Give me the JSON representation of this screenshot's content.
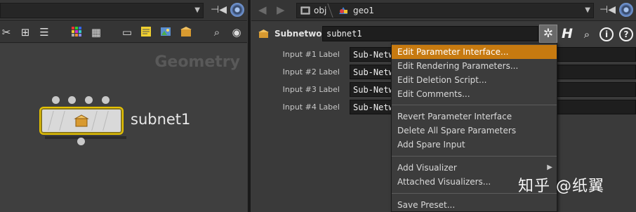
{
  "left_pane": {
    "network_label": "Geometry",
    "node": {
      "name": "subnet1"
    }
  },
  "right_pane": {
    "path": {
      "crumbs": [
        "obj",
        "geo1"
      ]
    },
    "node_type": "Subnetwork",
    "node_name": "subnet1",
    "parameters": [
      {
        "label": "Input #1 Label",
        "value": "Sub-Netw"
      },
      {
        "label": "Input #2 Label",
        "value": "Sub-Netw"
      },
      {
        "label": "Input #3 Label",
        "value": "Sub-Netw"
      },
      {
        "label": "Input #4 Label",
        "value": "Sub-Netw"
      }
    ]
  },
  "context_menu": {
    "items": [
      {
        "label": "Edit Parameter Interface...",
        "active": true
      },
      {
        "label": "Edit Rendering Parameters..."
      },
      {
        "label": "Edit Deletion Script..."
      },
      {
        "label": "Edit Comments..."
      },
      {
        "label": "Revert Parameter Interface"
      },
      {
        "label": "Delete All Spare Parameters"
      },
      {
        "label": "Add Spare Input"
      },
      {
        "label": "Add Visualizer",
        "submenu": true
      },
      {
        "label": "Attached Visualizers..."
      },
      {
        "label": "Save Preset..."
      }
    ]
  },
  "watermark": "知乎 @纸翼",
  "colors": {
    "menu_highlight": "#c77a10",
    "node_border": "#e6c200",
    "accent_blue": "#6c8fc8"
  },
  "icons": [
    "tools-icon",
    "tree-icon",
    "list-icon",
    "color-grid-icon",
    "table-icon",
    "network-box-icon",
    "sticky-note-icon",
    "image-icon",
    "subnet-icon",
    "search-icon",
    "eye-icon",
    "pin-icon",
    "target-icon",
    "gear-icon",
    "help-icon",
    "info-icon"
  ]
}
